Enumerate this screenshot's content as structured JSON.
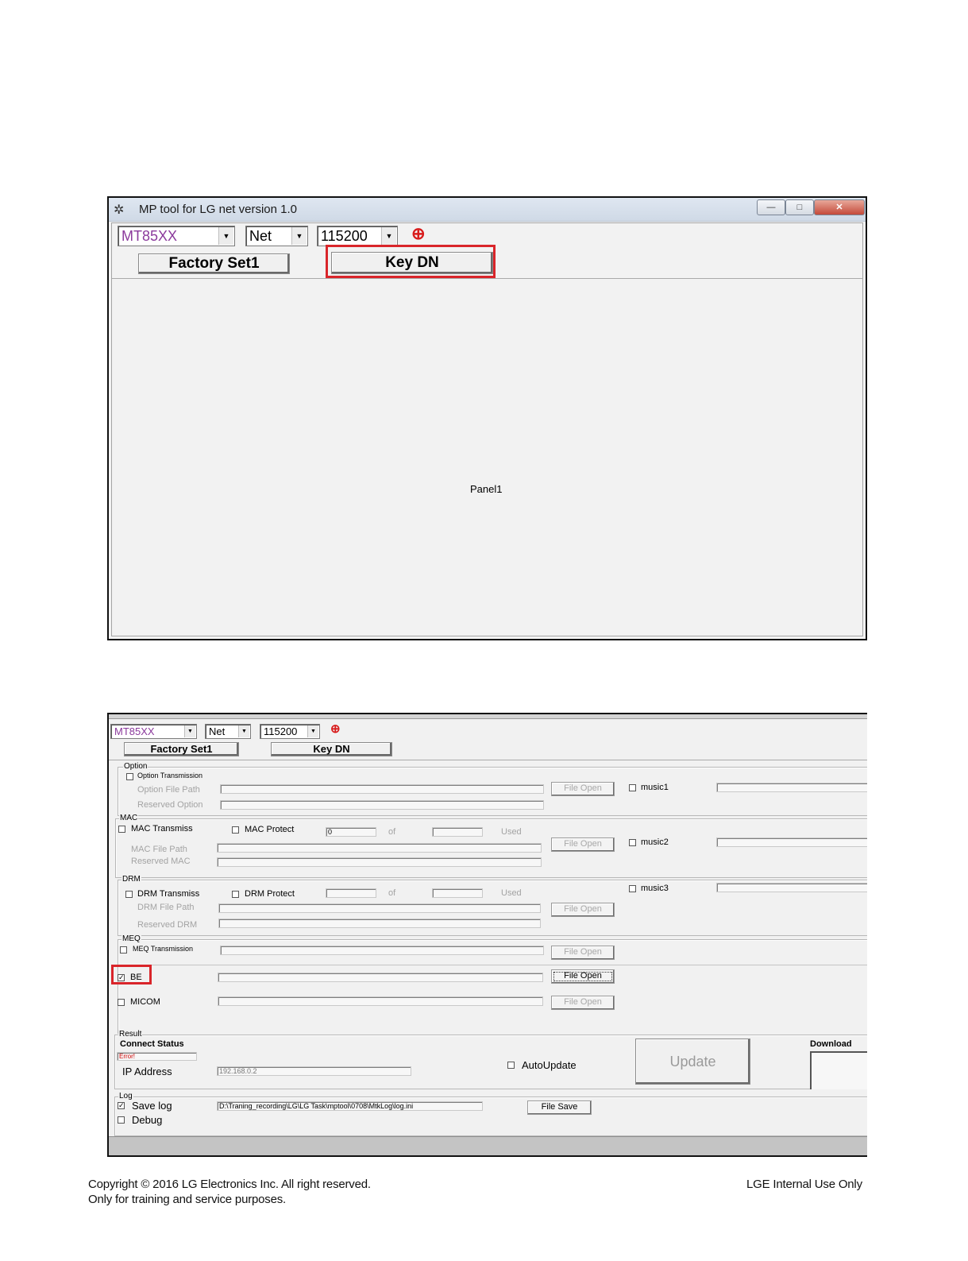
{
  "window1": {
    "title": "MP tool for LG net version 1.0",
    "controls": {
      "minimize": "—",
      "maximize": "□",
      "close": "✕"
    },
    "chip_select": "MT85XX",
    "conn_select": "Net",
    "baud_select": "115200",
    "factory_button": "Factory Set1",
    "keydn_button": "Key DN",
    "panel_label": "Panel1"
  },
  "window2": {
    "chip_select": "MT85XX",
    "conn_select": "Net",
    "baud_select": "115200",
    "factory_button": "Factory Set1",
    "keydn_button": "Key DN",
    "option": {
      "group": "Option",
      "transmission": "Option Transmission",
      "file_path": "Option File Path",
      "reserved": "Reserved Option",
      "file_open": "File Open",
      "music": "music1"
    },
    "mac": {
      "group": "MAC",
      "transmiss": "MAC Transmiss",
      "protect": "MAC Protect",
      "count": "0",
      "of": "of",
      "used": "Used",
      "file_path": "MAC File Path",
      "reserved": "Reserved MAC",
      "file_open": "File Open",
      "music": "music2"
    },
    "drm": {
      "group": "DRM",
      "transmiss": "DRM Transmiss",
      "protect": "DRM Protect",
      "of": "of",
      "used": "Used",
      "file_path": "DRM File Path",
      "reserved": "Reserved DRM",
      "file_open": "File Open",
      "music": "music3"
    },
    "meq": {
      "group": "MEQ",
      "transmission": "MEQ Transmission",
      "file_open": "File Open"
    },
    "be": {
      "label": "BE",
      "checked": true,
      "file_open": "File Open"
    },
    "micom": {
      "label": "MICOM",
      "file_open": "File Open"
    },
    "result": {
      "group": "Result",
      "connect_status": "Connect Status",
      "status_value": "Error!",
      "ip_label": "IP Address",
      "ip_value": "192.168.0.2",
      "auto_update": "AutoUpdate",
      "update_button": "Update",
      "download": "Download"
    },
    "log": {
      "group": "Log",
      "save_log": "Save log",
      "save_checked": true,
      "debug": "Debug",
      "path": "D:\\Traning_recording\\LG\\LG Task\\mptool\\0708\\MtkLog\\log.ini",
      "file_save": "File Save"
    }
  },
  "footer": {
    "copyright": "Copyright © 2016 LG Electronics Inc. All right reserved.",
    "purpose": "Only for training and service purposes.",
    "internal": "LGE Internal Use Only"
  },
  "colors": {
    "highlight": "#d9252a",
    "warning": "#d81b1b",
    "chip_text": "#8b3a9c",
    "error_text": "#cc0000"
  }
}
